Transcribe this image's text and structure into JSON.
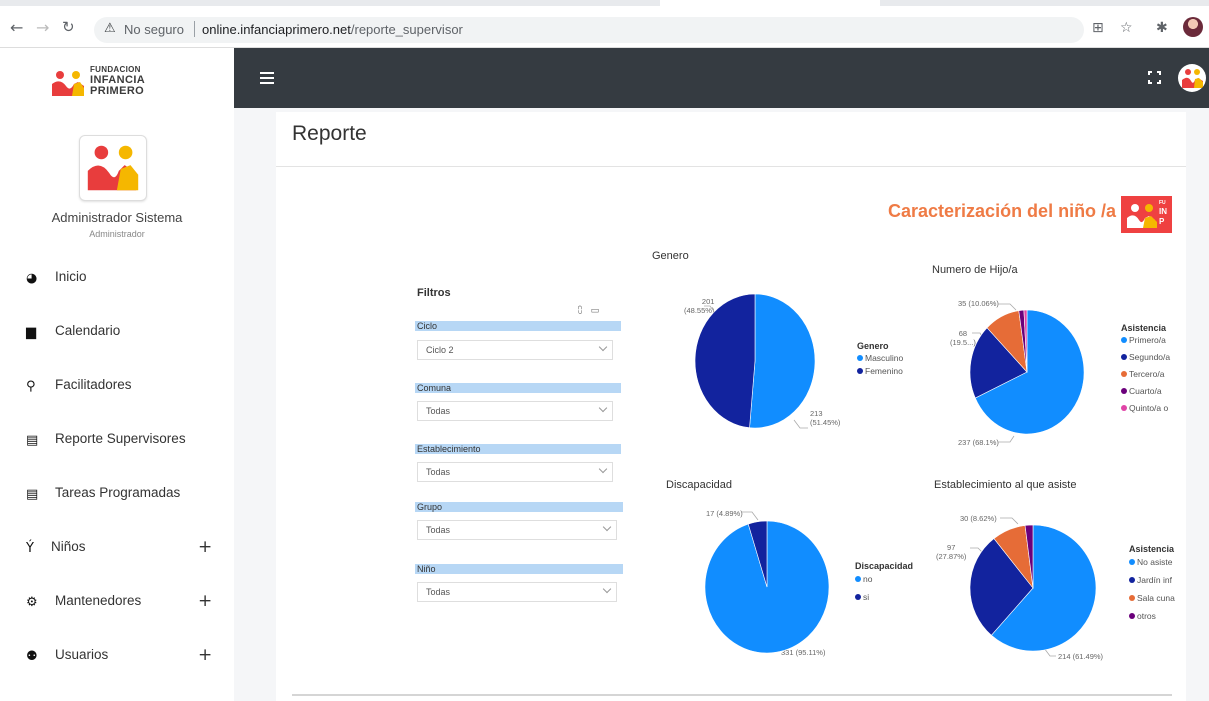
{
  "browser": {
    "security_label": "No seguro",
    "url_host": "online.infanciaprimero.net",
    "url_path": "/reporte_supervisor"
  },
  "sidebar": {
    "logo_line1": "FUNDACION",
    "logo_line2": "INFANCIA",
    "logo_line3": "PRIMERO",
    "user_name": "Administrador Sistema",
    "user_role": "Administrador",
    "items": [
      {
        "label": "Inicio",
        "icon": "dashboard-icon",
        "has_plus": false
      },
      {
        "label": "Calendario",
        "icon": "calendar-icon",
        "has_plus": false
      },
      {
        "label": "Facilitadores",
        "icon": "teacher-icon",
        "has_plus": false
      },
      {
        "label": "Reporte Supervisores",
        "icon": "clipboard-icon",
        "has_plus": false
      },
      {
        "label": "Tareas Programadas",
        "icon": "clipboard-icon",
        "has_plus": false
      },
      {
        "label": "Niños",
        "icon": "child-icon",
        "has_plus": true
      },
      {
        "label": "Mantenedores",
        "icon": "gears-icon",
        "has_plus": true
      },
      {
        "label": "Usuarios",
        "icon": "users-icon",
        "has_plus": true
      }
    ],
    "plus": "+"
  },
  "page": {
    "title": "Reporte"
  },
  "report": {
    "heading": "Caracterización del niño /a",
    "logo_text_1": "FU",
    "logo_text_2": "IN",
    "logo_text_3": "P",
    "filters_title": "Filtros",
    "filters": [
      {
        "label": "Ciclo",
        "value": "Ciclo 2"
      },
      {
        "label": "Comuna",
        "value": "Todas"
      },
      {
        "label": "Establecimiento",
        "value": "Todas"
      },
      {
        "label": "Grupo",
        "value": "Todas"
      },
      {
        "label": "Niño",
        "value": "Todas"
      }
    ]
  },
  "chart_data": [
    {
      "type": "pie",
      "title": "Genero",
      "legend_title": "Genero",
      "legend_position": "right",
      "slices": [
        {
          "label": "Masculino",
          "value": 213,
          "text": "213",
          "text2": "(51.45%)",
          "color": "#118dff"
        },
        {
          "label": "Femenino",
          "value": 201,
          "text": "201",
          "text2": "(48.55%)",
          "color": "#12239e"
        }
      ]
    },
    {
      "type": "pie",
      "title": "Numero de Hijo/a",
      "legend_title": "Asistencia",
      "legend_position": "right",
      "slices": [
        {
          "label": "Primero/a",
          "value": 237,
          "text": "237 (68.1%)",
          "color": "#118dff"
        },
        {
          "label": "Segundo/a",
          "value": 68,
          "text": "68",
          "text2": "(19.5...)",
          "color": "#12239e"
        },
        {
          "label": "Tercero/a",
          "value": 35,
          "text": "35 (10.06%)",
          "color": "#e66c37"
        },
        {
          "label": "Cuarto/a",
          "value": 5,
          "color": "#6b007b"
        },
        {
          "label": "Quinto/a o",
          "value": 3,
          "color": "#e044a7"
        }
      ]
    },
    {
      "type": "pie",
      "title": "Discapacidad",
      "legend_title": "Discapacidad",
      "legend_position": "right",
      "slices": [
        {
          "label": "no",
          "value": 331,
          "text": "331 (95.11%)",
          "color": "#118dff"
        },
        {
          "label": "si",
          "value": 17,
          "text": "17 (4.89%)",
          "color": "#12239e"
        }
      ]
    },
    {
      "type": "pie",
      "title": "Establecimiento al que asiste",
      "legend_title": "Asistencia",
      "legend_position": "right",
      "slices": [
        {
          "label": "No asiste",
          "value": 214,
          "text": "214 (61.49%)",
          "color": "#118dff"
        },
        {
          "label": "Jardín inf",
          "value": 97,
          "text": "97",
          "text2": "(27.87%)",
          "color": "#12239e"
        },
        {
          "label": "Sala cuna",
          "value": 30,
          "text": "30 (8.62%)",
          "color": "#e66c37"
        },
        {
          "label": "otros",
          "value": 7,
          "color": "#6b007b"
        }
      ]
    }
  ]
}
